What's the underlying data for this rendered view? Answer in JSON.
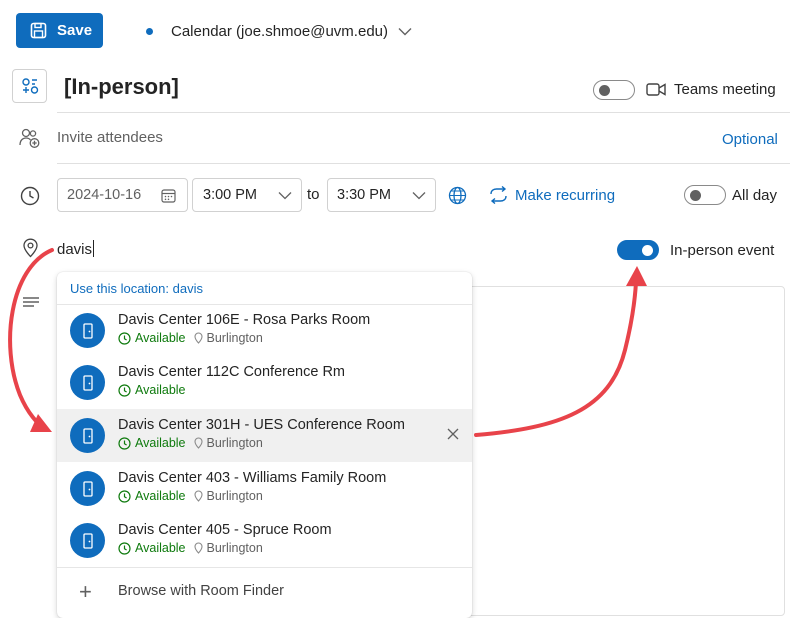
{
  "toolbar": {
    "save_label": "Save",
    "calendar_label": "Calendar (joe.shmoe@uvm.edu)"
  },
  "event": {
    "title": "[In-person]",
    "teams_label": "Teams meeting",
    "teams_on": false
  },
  "attendees": {
    "placeholder": "Invite attendees",
    "optional_label": "Optional"
  },
  "schedule": {
    "date": "2024-10-16",
    "start_time": "3:00 PM",
    "to_label": "to",
    "end_time": "3:30 PM",
    "recurring_label": "Make recurring",
    "all_day_label": "All day",
    "all_day_on": false
  },
  "location": {
    "value": "davis",
    "in_person_label": "In-person event",
    "in_person_on": true
  },
  "dropdown": {
    "use_location_label": "Use this location: davis",
    "rooms": [
      {
        "name": "Davis Center 106E - Rosa Parks Room",
        "status": "Available",
        "city": "Burlington"
      },
      {
        "name": "Davis Center 112C Conference Rm",
        "status": "Available",
        "city": ""
      },
      {
        "name": "Davis Center 301H - UES Conference Room",
        "status": "Available",
        "city": "Burlington"
      },
      {
        "name": "Davis Center 403 - Williams Family Room",
        "status": "Available",
        "city": "Burlington"
      },
      {
        "name": "Davis Center 405 - Spruce Room",
        "status": "Available",
        "city": "Burlington"
      }
    ],
    "browse_label": "Browse with Room Finder"
  },
  "colors": {
    "accent": "#0f6cbd",
    "available": "#0e7a0d",
    "annotation_arrow": "#e8434a"
  },
  "icons": {
    "save": "save-icon",
    "calendar_dot": "calendar-color-dot",
    "chevron": "chevron-down-icon",
    "title": "event-type-icon",
    "teams": "video-camera-icon",
    "attendees": "people-add-icon",
    "clock": "clock-icon",
    "date_picker": "calendar-icon",
    "timezone": "globe-icon",
    "recurring": "repeat-icon",
    "location": "location-pin-icon",
    "body": "text-lines-icon",
    "room": "door-icon",
    "availability": "clock-small-icon",
    "city": "pin-small-icon",
    "close": "close-icon",
    "browse": "plus-icon"
  }
}
